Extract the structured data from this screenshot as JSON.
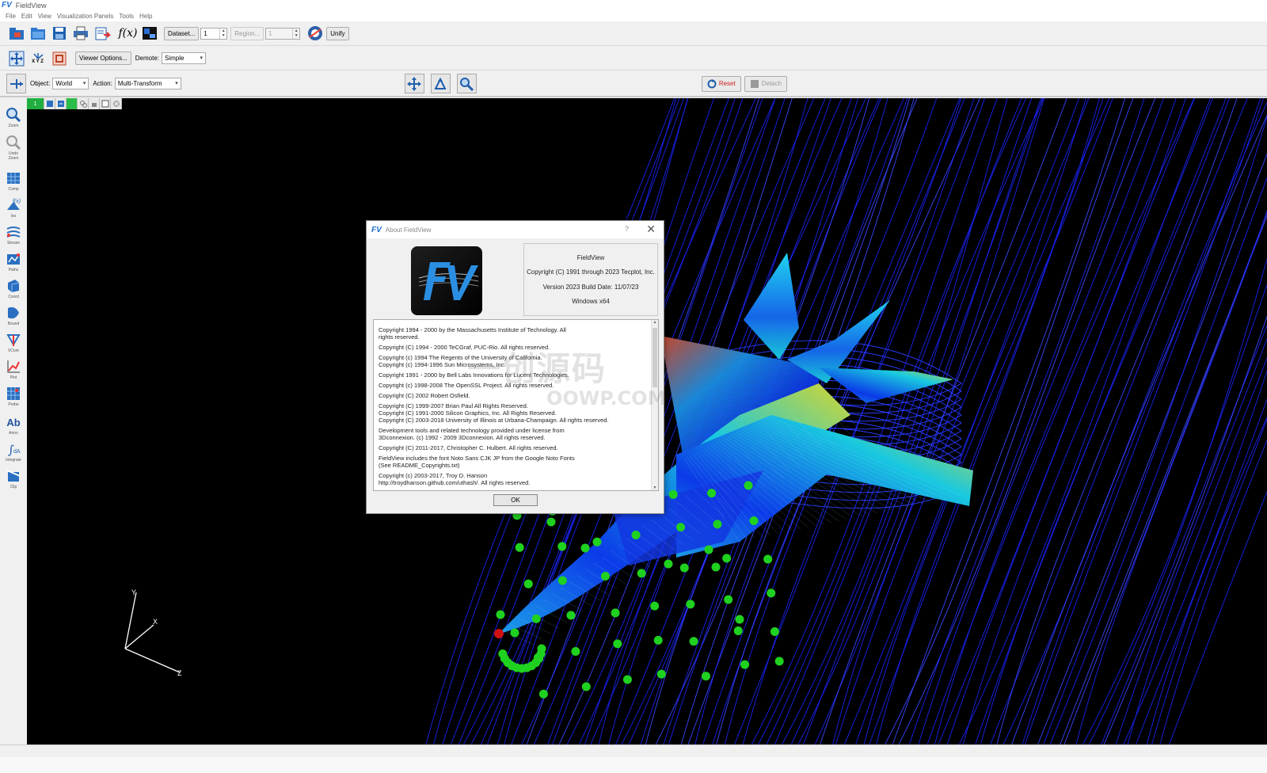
{
  "window": {
    "logo": "FV",
    "title": "FieldView"
  },
  "menu": [
    "File",
    "Edit",
    "View",
    "Visualization Panels",
    "Tools",
    "Help"
  ],
  "toolbar1": {
    "fx_label": "f(x)",
    "dataset_button": "Dataset...",
    "dataset_value": "1",
    "region_label": "Region...",
    "region_value": "1",
    "unify_button": "Unify"
  },
  "toolbar2": {
    "xyz_label": "X Y Z",
    "viewer_options_button": "Viewer Options...",
    "demote_label": "Demote:",
    "demote_value": "Simple"
  },
  "toolbar3": {
    "object_label": "Object:",
    "object_value": "World",
    "action_label": "Action:",
    "action_value": "Multi-Transform",
    "reset_button": "Reset",
    "detach_button": "Detach"
  },
  "viewer_tab": "1",
  "sidebar_tools": [
    "Zoom",
    "Undo Zoom",
    "Comp",
    "Iso",
    "Stream",
    "Paths",
    "Coord",
    "Bound",
    "VCore",
    "Plot",
    "Probe",
    "Anno",
    "Integrate",
    "Clip"
  ],
  "sidebar_anno_glyph": "Ab",
  "axes": {
    "x": "X",
    "y": "Y",
    "z": "Z"
  },
  "dialog": {
    "title_logo": "FV",
    "title": "About FieldView",
    "help": "?",
    "close": "✕",
    "info_lines": [
      "FieldView",
      "Copyright (C) 1991 through 2023 Tecplot, Inc.",
      "Version 2023  Build Date: 11/07/23",
      "Windows x64"
    ],
    "paragraphs": [
      "Copyright 1994 - 2000 by the Massachusetts Institute of Technology.  All\nrights reserved.",
      "Copyright (C) 1994 - 2000 TeCGraf, PUC-Rio.  All rights reserved.",
      "Copyright (c) 1994 The Regents of the University of California.\nCopyright (c) 1994-1996 Sun Microsystems, Inc.",
      "Copyright 1991 - 2000 by Bell Labs Innovations for Lucent Technologies.",
      "Copyright (c) 1998-2008 The OpenSSL Project.  All rights reserved.",
      "Copyright (C) 2002 Robert Osfield.",
      "Copyright (C) 1999-2007  Brian Paul   All Rights Reserved.\nCopyright (C) 1991-2000 Silicon Graphics, Inc. All Rights Reserved.\nCopyright (C) 2003-2018 University of Illinois at Urbana-Champaign. All rights reserved.",
      "Development tools and related technology provided under license from\n3Dconnexion. (c) 1992 - 2009 3Dconnexion. All rights reserved.",
      "Copyright (C) 2011-2017, Christopher C. Hulbert.  All rights reserved.",
      "FieldView includes the font Noto Sans CJK JP from the Google Noto Fonts\n(See README_Copyrights.txt)",
      "Copyright (c) 2003-2017, Troy D. Hanson\nhttp://troydhanson.github.com/uthash/.  All rights reserved."
    ],
    "ok_button": "OK"
  },
  "watermark": {
    "line1": "一创源码",
    "line2": "OOWP.COM"
  }
}
